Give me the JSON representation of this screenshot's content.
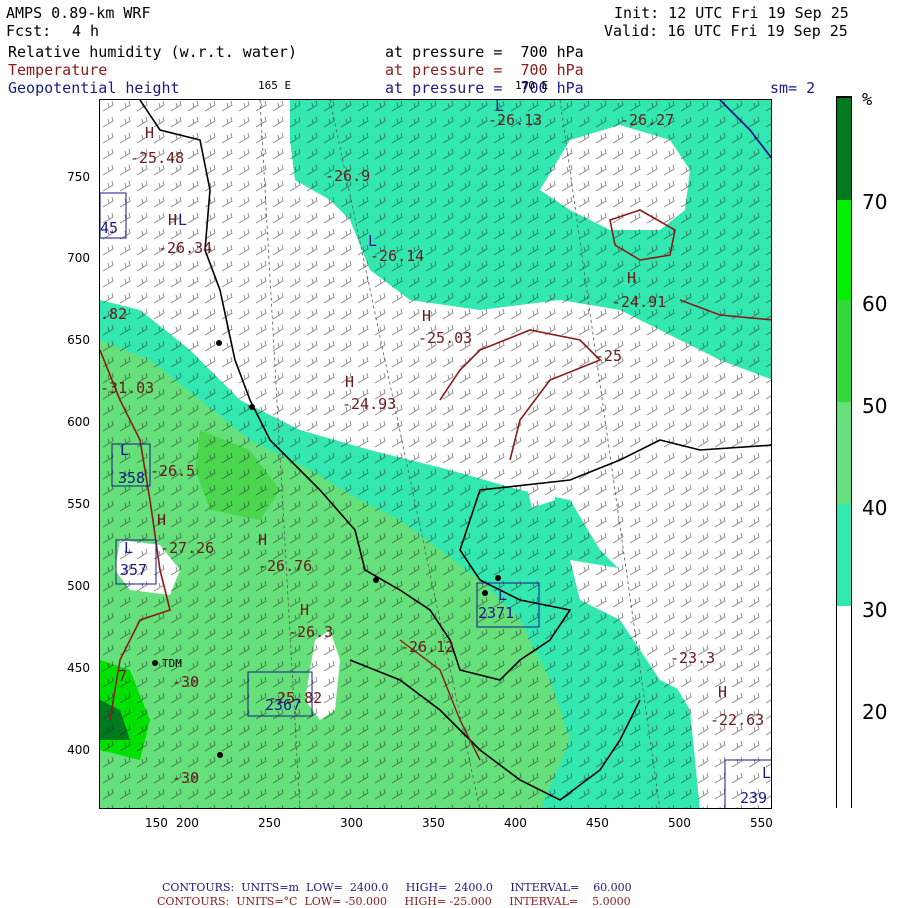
{
  "header": {
    "model": "AMPS 0.89-km WRF",
    "fcst_label": "Fcst:",
    "fcst_value": "4 h",
    "init": "Init: 12 UTC Fri 19 Sep 25",
    "valid": "Valid: 16 UTC Fri 19 Sep 25",
    "fields": [
      {
        "name": "Relative humidity (w.r.t. water)",
        "pressure": "at pressure =  700 hPa",
        "color": "#000000"
      },
      {
        "name": "Temperature",
        "pressure": "at pressure =  700 hPa",
        "color": "#8b1a1a"
      },
      {
        "name": "Geopotential height",
        "pressure": "at pressure =  700 hPa",
        "color": "#1a1a8b"
      }
    ],
    "smoothing": "sm= 2"
  },
  "map": {
    "meridian_labels": [
      "165 E",
      "170 E"
    ],
    "x_ticks": [
      "150",
      "200",
      "250",
      "300",
      "350",
      "400",
      "450",
      "500",
      "550"
    ],
    "y_ticks": [
      "750",
      "700",
      "650",
      "600",
      "550",
      "500",
      "450",
      "400"
    ],
    "station_label": "TDM",
    "contour_labels": [
      {
        "text": "-25.48",
        "kind": "temp"
      },
      {
        "text": "-26.9",
        "kind": "temp"
      },
      {
        "text": "-26.13",
        "kind": "temp"
      },
      {
        "text": "-26.27",
        "kind": "temp"
      },
      {
        "text": "-26.34",
        "kind": "temp"
      },
      {
        "text": "-26.14",
        "kind": "temp"
      },
      {
        "text": "-24.91",
        "kind": "temp"
      },
      {
        "text": "-25.03",
        "kind": "temp"
      },
      {
        "text": "-25",
        "kind": "temp"
      },
      {
        "text": "-24.93",
        "kind": "temp"
      },
      {
        "text": "-26.5",
        "kind": "temp"
      },
      {
        "text": "-27.26",
        "kind": "temp"
      },
      {
        "text": "-26.76",
        "kind": "temp"
      },
      {
        "text": "-26.3",
        "kind": "temp"
      },
      {
        "text": "-26.12",
        "kind": "temp"
      },
      {
        "text": "-25.82",
        "kind": "temp"
      },
      {
        "text": "-23.3",
        "kind": "temp"
      },
      {
        "text": "-22.63",
        "kind": "temp"
      },
      {
        "text": "-30",
        "kind": "temp"
      },
      {
        "text": "-30",
        "kind": "temp"
      },
      {
        "text": ".82",
        "kind": "temp"
      },
      {
        "text": "-31.03",
        "kind": "temp"
      },
      {
        "text": "45",
        "kind": "height"
      },
      {
        "text": "358",
        "kind": "height"
      },
      {
        "text": "357",
        "kind": "height"
      },
      {
        "text": "2367",
        "kind": "height"
      },
      {
        "text": "2371",
        "kind": "height"
      },
      {
        "text": "239",
        "kind": "height"
      },
      {
        "text": "7",
        "kind": "temp"
      }
    ],
    "H_marks": 9,
    "L_marks": 7
  },
  "colorbar": {
    "unit": "%",
    "labels": [
      "70",
      "60",
      "50",
      "40",
      "30",
      "20"
    ],
    "colors": [
      "#ffffff",
      "#33e8b0",
      "#66e07a",
      "#33d83a",
      "#00f000",
      "#007a1e"
    ]
  },
  "footer": {
    "line1": {
      "label": "CONTOURS:",
      "units": "UNITS=m",
      "low": "LOW=  2400.0",
      "high": "HIGH=  2400.0",
      "interval": "INTERVAL=    60.000",
      "color": "#1a1a8b"
    },
    "line2": {
      "label": "CONTOURS:",
      "units": "UNITS=°C",
      "low": "LOW= -50.000",
      "high": "HIGH= -25.000",
      "interval": "INTERVAL=    5.0000",
      "color": "#8b1a1a"
    }
  }
}
